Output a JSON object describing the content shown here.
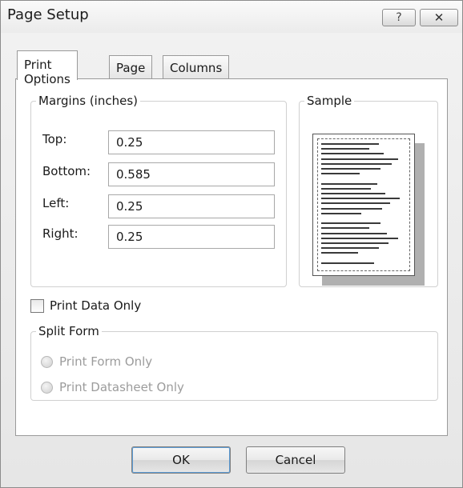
{
  "dialog": {
    "title": "Page Setup",
    "help_label": "?",
    "close_label": "✕"
  },
  "tabs": [
    {
      "label": "Print Options",
      "active": true
    },
    {
      "label": "Page",
      "active": false
    },
    {
      "label": "Columns",
      "active": false
    }
  ],
  "margins": {
    "legend": "Margins (inches)",
    "rows": [
      {
        "label": "Top:",
        "value": "0.25"
      },
      {
        "label": "Bottom:",
        "value": "0.585"
      },
      {
        "label": "Left:",
        "value": "0.25"
      },
      {
        "label": "Right:",
        "value": "0.25"
      }
    ]
  },
  "sample": {
    "legend": "Sample"
  },
  "print_data_only": {
    "label": "Print Data Only",
    "checked": false
  },
  "split_form": {
    "legend": "Split Form",
    "options": [
      {
        "label": "Print Form Only",
        "enabled": false
      },
      {
        "label": "Print Datasheet Only",
        "enabled": false
      }
    ]
  },
  "buttons": {
    "ok": "OK",
    "cancel": "Cancel"
  }
}
